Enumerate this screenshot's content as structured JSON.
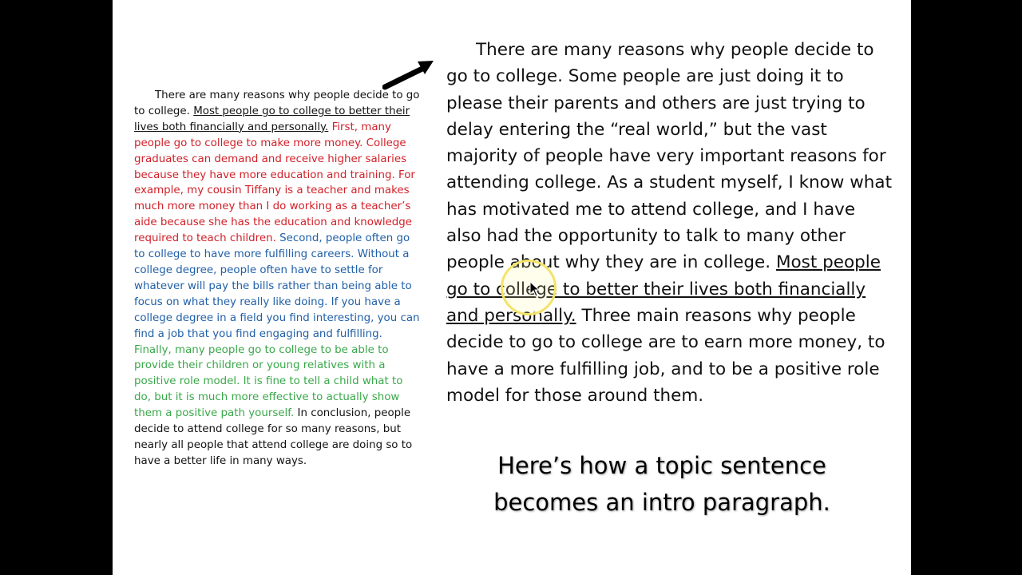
{
  "left_paragraph": {
    "intro": "There are many reasons why people decide to go to college.",
    "thesis": "Most people go to college to better their lives both financially and personally.",
    "point_first": "First, many people go to college to make more money. College graduates can demand and receive higher salaries because they have more education and training. For example, my cousin Tiffany is a teacher and makes much more money than I do working as a teacher’s aide because she has the education and knowledge required to teach children.",
    "point_second": "Second, people often go to college to have more fulfilling careers. Without a college degree, people often have to settle for whatever will pay the bills rather than being able to focus on what they really like doing. If you have a college degree in a field you find interesting, you can find a job that you find engaging and fulfilling.",
    "point_final": "Finally, many people go to college to be able to provide their children or young relatives with a positive role model. It is fine to tell a child what to do, but it is much more effective to actually show them a positive path yourself.",
    "conclusion": "In conclusion, people decide to attend college for so many reasons, but nearly all people that attend college are doing so to have a better life in many ways."
  },
  "right_paragraph": {
    "intro": "There are many reasons why people decide to go to college. Some people are just doing it to please their parents and others are just trying to delay entering the “real world,” but the vast majority of people have very important reasons for attending college. As a student myself, I know what has motivated me to attend college, and I have also had the opportunity to talk to many other people about why they are in college.",
    "thesis": "Most people go to college to better their lives both financially and personally.",
    "preview": "Three main reasons why people decide to go to college are to earn more money, to have a more fulfilling job, and to be a positive role model for those around them."
  },
  "caption": "Here’s how a topic sentence becomes an intro paragraph.",
  "colors": {
    "background": "#000000",
    "slide": "#ffffff",
    "first_point": "#d01f27",
    "second_point": "#1f5fa8",
    "final_point": "#3aa84a",
    "cursor_highlight": "#f3e36a"
  },
  "icons": {
    "arrow": "arrow-pointing-right-icon",
    "cursor": "mouse-pointer-icon"
  }
}
